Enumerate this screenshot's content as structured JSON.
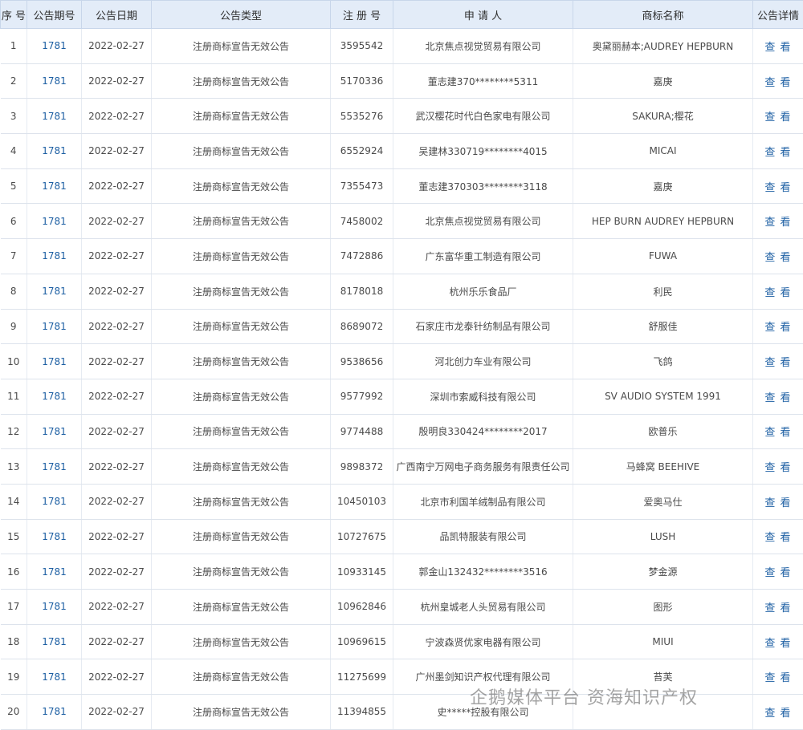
{
  "headers": {
    "seq": "序 号",
    "issue": "公告期号",
    "date": "公告日期",
    "type": "公告类型",
    "reg_no": "注 册 号",
    "applicant": "申 请 人",
    "mark": "商标名称",
    "detail": "公告详情"
  },
  "rows": [
    {
      "seq": "1",
      "issue": "1781",
      "date": "2022-02-27",
      "type": "注册商标宣告无效公告",
      "reg_no": "3595542",
      "applicant": "北京焦点视觉贸易有限公司",
      "mark": "奥黛丽赫本;AUDREY HEPBURN",
      "detail": "查 看"
    },
    {
      "seq": "2",
      "issue": "1781",
      "date": "2022-02-27",
      "type": "注册商标宣告无效公告",
      "reg_no": "5170336",
      "applicant": "董志建370********5311",
      "mark": "嘉庚",
      "detail": "查 看"
    },
    {
      "seq": "3",
      "issue": "1781",
      "date": "2022-02-27",
      "type": "注册商标宣告无效公告",
      "reg_no": "5535276",
      "applicant": "武汉樱花时代白色家电有限公司",
      "mark": "SAKURA;樱花",
      "detail": "查 看"
    },
    {
      "seq": "4",
      "issue": "1781",
      "date": "2022-02-27",
      "type": "注册商标宣告无效公告",
      "reg_no": "6552924",
      "applicant": "吴建林330719********4015",
      "mark": "MICAI",
      "detail": "查 看"
    },
    {
      "seq": "5",
      "issue": "1781",
      "date": "2022-02-27",
      "type": "注册商标宣告无效公告",
      "reg_no": "7355473",
      "applicant": "董志建370303********3118",
      "mark": "嘉庚",
      "detail": "查 看"
    },
    {
      "seq": "6",
      "issue": "1781",
      "date": "2022-02-27",
      "type": "注册商标宣告无效公告",
      "reg_no": "7458002",
      "applicant": "北京焦点视觉贸易有限公司",
      "mark": "HEP BURN AUDREY HEPBURN",
      "detail": "查 看"
    },
    {
      "seq": "7",
      "issue": "1781",
      "date": "2022-02-27",
      "type": "注册商标宣告无效公告",
      "reg_no": "7472886",
      "applicant": "广东富华重工制造有限公司",
      "mark": "FUWA",
      "detail": "查 看"
    },
    {
      "seq": "8",
      "issue": "1781",
      "date": "2022-02-27",
      "type": "注册商标宣告无效公告",
      "reg_no": "8178018",
      "applicant": "杭州乐乐食品厂",
      "mark": "利民",
      "detail": "查 看"
    },
    {
      "seq": "9",
      "issue": "1781",
      "date": "2022-02-27",
      "type": "注册商标宣告无效公告",
      "reg_no": "8689072",
      "applicant": "石家庄市龙泰针纺制品有限公司",
      "mark": "舒服佳",
      "detail": "查 看"
    },
    {
      "seq": "10",
      "issue": "1781",
      "date": "2022-02-27",
      "type": "注册商标宣告无效公告",
      "reg_no": "9538656",
      "applicant": "河北创力车业有限公司",
      "mark": "飞鸽",
      "detail": "查 看"
    },
    {
      "seq": "11",
      "issue": "1781",
      "date": "2022-02-27",
      "type": "注册商标宣告无效公告",
      "reg_no": "9577992",
      "applicant": "深圳市索威科技有限公司",
      "mark": "SV AUDIO SYSTEM 1991",
      "detail": "查 看"
    },
    {
      "seq": "12",
      "issue": "1781",
      "date": "2022-02-27",
      "type": "注册商标宣告无效公告",
      "reg_no": "9774488",
      "applicant": "殷明良330424********2017",
      "mark": "欧普乐",
      "detail": "查 看"
    },
    {
      "seq": "13",
      "issue": "1781",
      "date": "2022-02-27",
      "type": "注册商标宣告无效公告",
      "reg_no": "9898372",
      "applicant": "广西南宁万网电子商务服务有限责任公司",
      "mark": "马蜂窝 BEEHIVE",
      "detail": "查 看"
    },
    {
      "seq": "14",
      "issue": "1781",
      "date": "2022-02-27",
      "type": "注册商标宣告无效公告",
      "reg_no": "10450103",
      "applicant": "北京市利国羊绒制品有限公司",
      "mark": "爱奥马仕",
      "detail": "查 看"
    },
    {
      "seq": "15",
      "issue": "1781",
      "date": "2022-02-27",
      "type": "注册商标宣告无效公告",
      "reg_no": "10727675",
      "applicant": "品凯特服装有限公司",
      "mark": "LUSH",
      "detail": "查 看"
    },
    {
      "seq": "16",
      "issue": "1781",
      "date": "2022-02-27",
      "type": "注册商标宣告无效公告",
      "reg_no": "10933145",
      "applicant": "郭金山132432********3516",
      "mark": "梦金源",
      "detail": "查 看"
    },
    {
      "seq": "17",
      "issue": "1781",
      "date": "2022-02-27",
      "type": "注册商标宣告无效公告",
      "reg_no": "10962846",
      "applicant": "杭州皇城老人头贸易有限公司",
      "mark": "图形",
      "detail": "查 看"
    },
    {
      "seq": "18",
      "issue": "1781",
      "date": "2022-02-27",
      "type": "注册商标宣告无效公告",
      "reg_no": "10969615",
      "applicant": "宁波森贤优家电器有限公司",
      "mark": "MIUI",
      "detail": "查 看"
    },
    {
      "seq": "19",
      "issue": "1781",
      "date": "2022-02-27",
      "type": "注册商标宣告无效公告",
      "reg_no": "11275699",
      "applicant": "广州墨剑知识产权代理有限公司",
      "mark": "苔芙",
      "detail": "查 看"
    },
    {
      "seq": "20",
      "issue": "1781",
      "date": "2022-02-27",
      "type": "注册商标宣告无效公告",
      "reg_no": "11394855",
      "applicant": "史*****控股有限公司",
      "mark": "",
      "detail": "查 看"
    }
  ],
  "watermark": "企鹅媒体平台 资海知识产权"
}
